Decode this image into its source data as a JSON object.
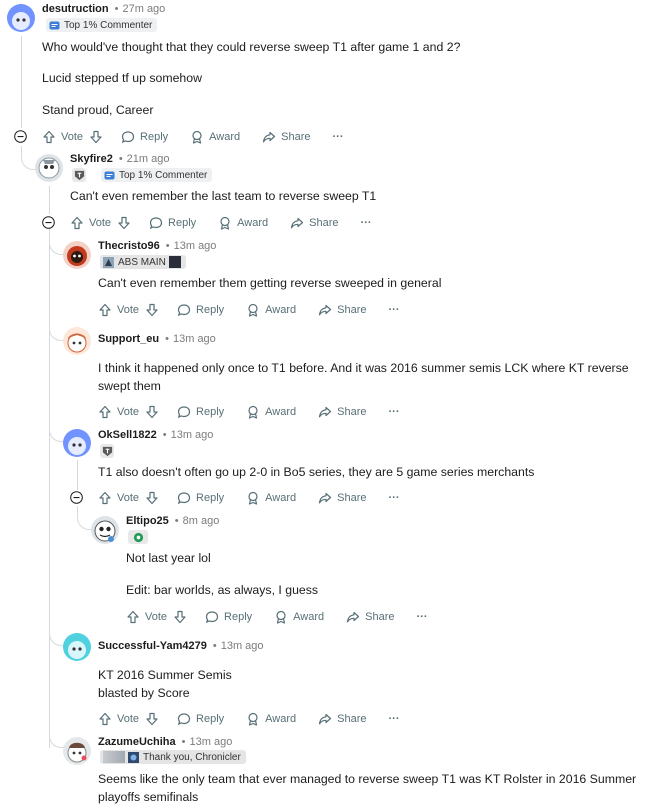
{
  "action_labels": {
    "vote": "Vote",
    "reply": "Reply",
    "award": "Award",
    "share": "Share",
    "more": "···"
  },
  "comments": [
    {
      "username": "desutruction",
      "time": "27m ago",
      "flair": "Top 1% Commenter",
      "paragraphs": [
        "Who would've thought that they could reverse sweep T1 after game 1 and 2?",
        "Lucid stepped tf up somehow",
        "Stand proud, Career"
      ]
    },
    {
      "username": "Skyfire2",
      "time": "21m ago",
      "flair": "Top 1% Commenter",
      "paragraphs": [
        "Can't even remember the last team to reverse sweep T1"
      ]
    },
    {
      "username": "Thecristo96",
      "time": "13m ago",
      "flair": "ABS MAIN",
      "paragraphs": [
        "Can't even remember them getting reverse sweeped in general"
      ]
    },
    {
      "username": "Support_eu",
      "time": "13m ago",
      "paragraphs": [
        "I think it happened only once to T1 before. And it was 2016 summer semis LCK where KT reverse swept them"
      ]
    },
    {
      "username": "OkSell1822",
      "time": "13m ago",
      "paragraphs": [
        "T1 also doesn't often go up 2-0 in Bo5 series, they are 5 game series merchants"
      ]
    },
    {
      "username": "Eltipo25",
      "time": "8m ago",
      "paragraphs": [
        "Not last year lol",
        "Edit: bar worlds, as always, I guess"
      ]
    },
    {
      "username": "Successful-Yam4279",
      "time": "13m ago",
      "paragraphs": [
        "KT 2016 Summer Semis",
        "blasted by Score"
      ]
    },
    {
      "username": "ZazumeUchiha",
      "time": "13m ago",
      "flair": "Thank you, Chronicler",
      "paragraphs": [
        "Seems like the only team that ever managed to reverse sweep T1 was KT Rolster in 2016 Summer playoffs semifinals"
      ]
    }
  ]
}
